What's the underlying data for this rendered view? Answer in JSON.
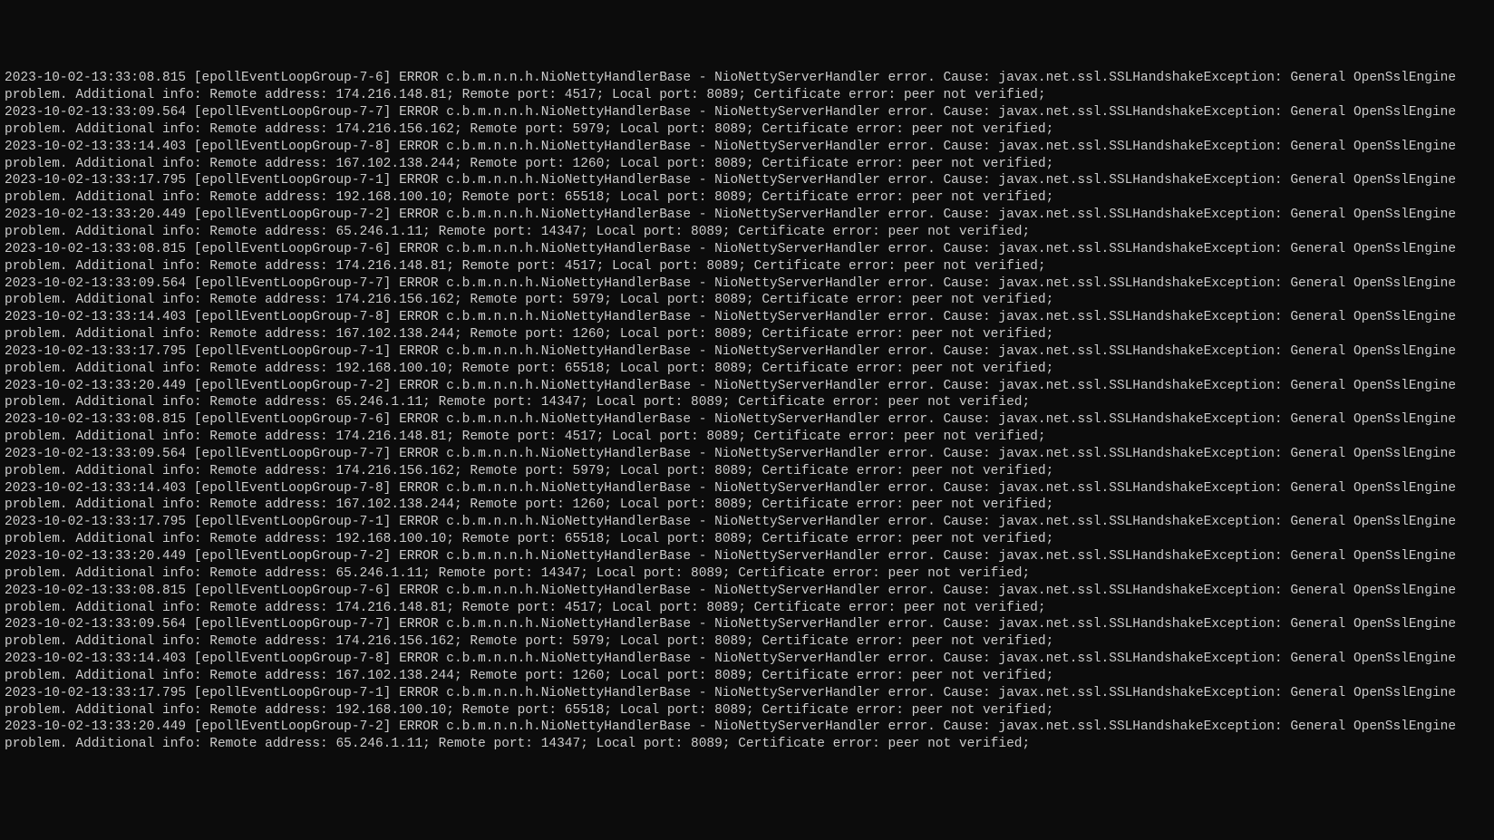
{
  "log_template": {
    "line1_prefix": "",
    "thread_prefix": " [epollEventLoopGroup-7-",
    "thread_suffix": "] ERROR c.b.m.n.n.h.NioNettyHandlerBase - NioNettyServerHandler error. Cause: javax.net.ssl.SSLHandshakeException: General OpenSslEngine problem. Additional info: Remote address: ",
    "remote_port_prefix": "; Remote port: ",
    "local_port_prefix": "; Local port: ",
    "suffix": "; Certificate error: peer not verified;"
  },
  "entries": [
    {
      "ts": "2023-10-02-13:33:08.815",
      "thread": "6",
      "addr": "174.216.148.81",
      "rport": "4517",
      "lport": "8089"
    },
    {
      "ts": "2023-10-02-13:33:09.564",
      "thread": "7",
      "addr": "174.216.156.162",
      "rport": "5979",
      "lport": "8089"
    },
    {
      "ts": "2023-10-02-13:33:14.403",
      "thread": "8",
      "addr": "167.102.138.244",
      "rport": "1260",
      "lport": "8089"
    },
    {
      "ts": "2023-10-02-13:33:17.795",
      "thread": "1",
      "addr": "192.168.100.10",
      "rport": "65518",
      "lport": "8089"
    },
    {
      "ts": "2023-10-02-13:33:20.449",
      "thread": "2",
      "addr": "65.246.1.11",
      "rport": "14347",
      "lport": "8089"
    },
    {
      "ts": "2023-10-02-13:33:08.815",
      "thread": "6",
      "addr": "174.216.148.81",
      "rport": "4517",
      "lport": "8089"
    },
    {
      "ts": "2023-10-02-13:33:09.564",
      "thread": "7",
      "addr": "174.216.156.162",
      "rport": "5979",
      "lport": "8089"
    },
    {
      "ts": "2023-10-02-13:33:14.403",
      "thread": "8",
      "addr": "167.102.138.244",
      "rport": "1260",
      "lport": "8089"
    },
    {
      "ts": "2023-10-02-13:33:17.795",
      "thread": "1",
      "addr": "192.168.100.10",
      "rport": "65518",
      "lport": "8089"
    },
    {
      "ts": "2023-10-02-13:33:20.449",
      "thread": "2",
      "addr": "65.246.1.11",
      "rport": "14347",
      "lport": "8089"
    },
    {
      "ts": "2023-10-02-13:33:08.815",
      "thread": "6",
      "addr": "174.216.148.81",
      "rport": "4517",
      "lport": "8089"
    },
    {
      "ts": "2023-10-02-13:33:09.564",
      "thread": "7",
      "addr": "174.216.156.162",
      "rport": "5979",
      "lport": "8089"
    },
    {
      "ts": "2023-10-02-13:33:14.403",
      "thread": "8",
      "addr": "167.102.138.244",
      "rport": "1260",
      "lport": "8089"
    },
    {
      "ts": "2023-10-02-13:33:17.795",
      "thread": "1",
      "addr": "192.168.100.10",
      "rport": "65518",
      "lport": "8089"
    },
    {
      "ts": "2023-10-02-13:33:20.449",
      "thread": "2",
      "addr": "65.246.1.11",
      "rport": "14347",
      "lport": "8089"
    },
    {
      "ts": "2023-10-02-13:33:08.815",
      "thread": "6",
      "addr": "174.216.148.81",
      "rport": "4517",
      "lport": "8089"
    },
    {
      "ts": "2023-10-02-13:33:09.564",
      "thread": "7",
      "addr": "174.216.156.162",
      "rport": "5979",
      "lport": "8089"
    },
    {
      "ts": "2023-10-02-13:33:14.403",
      "thread": "8",
      "addr": "167.102.138.244",
      "rport": "1260",
      "lport": "8089"
    },
    {
      "ts": "2023-10-02-13:33:17.795",
      "thread": "1",
      "addr": "192.168.100.10",
      "rport": "65518",
      "lport": "8089"
    },
    {
      "ts": "2023-10-02-13:33:20.449",
      "thread": "2",
      "addr": "65.246.1.11",
      "rport": "14347",
      "lport": "8089"
    }
  ]
}
